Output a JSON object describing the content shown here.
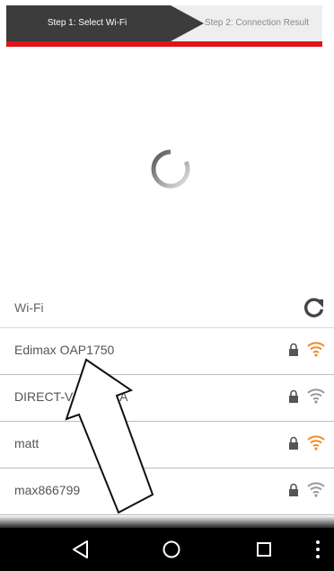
{
  "stepper": {
    "step1_label": "Step 1: Select Wi-Fi",
    "step2_label": "Step 2: Connection Result",
    "accent_color": "#e0141b",
    "active_step": 1
  },
  "loading": {
    "icon": "loading-spinner-icon"
  },
  "wifi": {
    "header_label": "Wi-Fi",
    "refresh_icon": "refresh-icon",
    "networks": [
      {
        "ssid": "Edimax OAP1750",
        "secured": true,
        "signal_color": "#f28c28"
      },
      {
        "ssid": "DIRECT-V8",
        "secured": true,
        "signal_color": "#9a9a9a"
      },
      {
        "ssid": "matt",
        "secured": true,
        "signal_color": "#f28c28"
      },
      {
        "ssid": "max866799",
        "secured": true,
        "signal_color": "#9a9a9a"
      }
    ],
    "network_row_trailing_text": "A"
  },
  "navbar": {
    "back_icon": "back-triangle-icon",
    "home_icon": "home-circle-icon",
    "recents_icon": "recents-square-icon",
    "menu_icon": "overflow-menu-icon"
  },
  "overlay": {
    "icon": "pointer-arrow-icon"
  }
}
